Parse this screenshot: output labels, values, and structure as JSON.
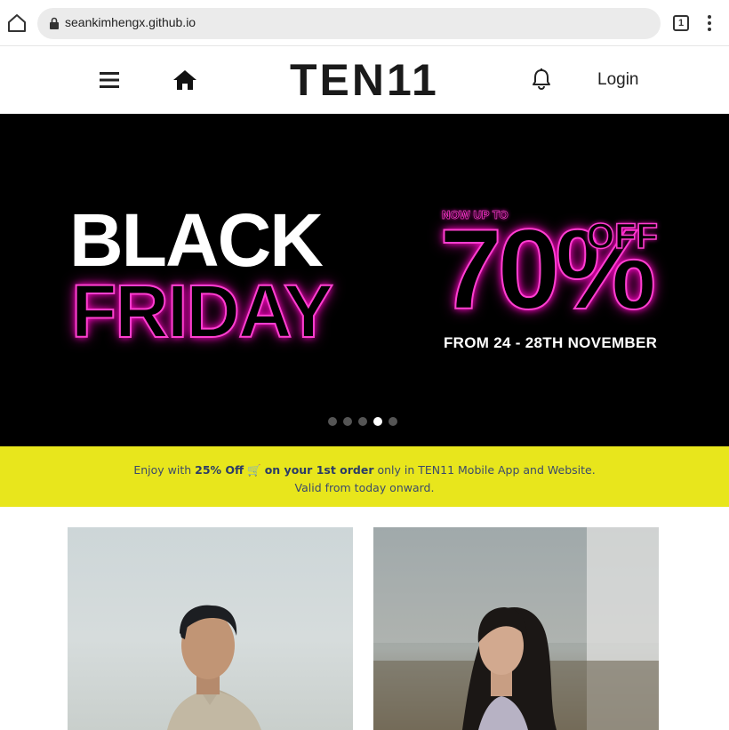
{
  "browser": {
    "url": "seankimhengx.github.io",
    "tab_count": "1"
  },
  "header": {
    "logo": "TEN11",
    "login_label": "Login"
  },
  "banner": {
    "line1": "BLACK",
    "line2": "FRIDAY",
    "now_up_to": "NOW UP TO",
    "percent": "70%",
    "off": "OFF",
    "dates": "FROM 24 - 28TH NOVEMBER",
    "slide_count": 5,
    "active_slide": 4,
    "neon_color": "#ff3fd0"
  },
  "promo": {
    "prefix": "Enjoy with ",
    "discount": "25% Off",
    "cart_emoji": "🛒",
    "first_order": "on your 1st order",
    "suffix": " only in TEN11 Mobile App and Website.",
    "line2": "Valid from today onward.",
    "background": "#e8e61c"
  },
  "products": [
    {
      "alt": "male model photo"
    },
    {
      "alt": "female model photo"
    }
  ]
}
